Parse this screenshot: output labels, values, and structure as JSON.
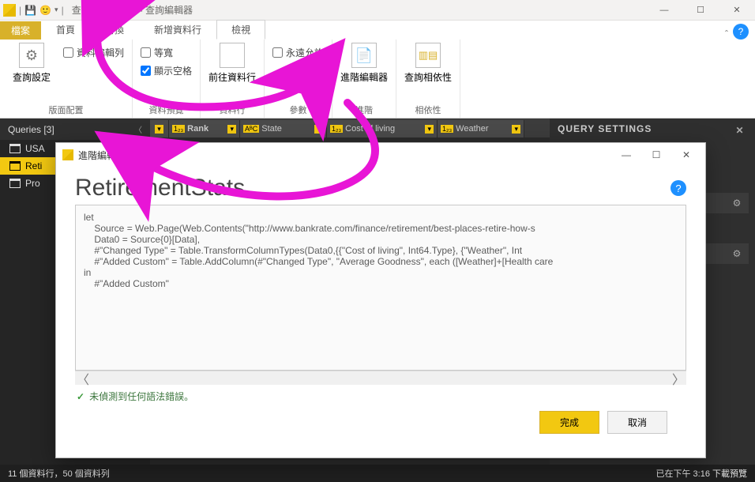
{
  "titlebar": {
    "title": "查詢工作 - 完成 - 查詢編輯器"
  },
  "ribbon": {
    "file": "檔案",
    "tabs": [
      "首頁",
      "轉換",
      "新增資料行",
      "檢視"
    ],
    "active_tab_index": 3,
    "group_layout": {
      "label": "版面配置",
      "query_settings": "查詢設定",
      "chk_formula_bar": "資料編輯列"
    },
    "group_preview": {
      "label": "資料預覽",
      "chk_monospace": "等寬",
      "chk_show_space": "顯示空格",
      "goto_col": "前往資料行"
    },
    "group_cols": {
      "label": "資料行"
    },
    "group_params": {
      "label": "參數",
      "chk_always_allow": "永遠允許"
    },
    "group_adv": {
      "label": "進階",
      "adv_editor": "進階編輯器"
    },
    "group_dep": {
      "label": "相依性",
      "dep_btn": "查詢相依性"
    }
  },
  "queries": {
    "header": "Queries [3]",
    "items": [
      "USA...",
      "RetirementStats",
      "Products"
    ],
    "items_short": [
      "USA",
      "Reti",
      "Pro"
    ],
    "selected_index": 1
  },
  "columns": [
    {
      "type": "1₂₃",
      "name": "Rank"
    },
    {
      "type": "AᴮC",
      "name": "State"
    },
    {
      "type": "1₂₃",
      "name": "Cost of living"
    },
    {
      "type": "1₂₃",
      "name": "Weather"
    }
  ],
  "settings": {
    "title": "QUERY SETTINGS"
  },
  "modal": {
    "win_title": "進階編輯器",
    "heading": "RetirementStats",
    "code": "let\n    Source = Web.Page(Web.Contents(\"http://www.bankrate.com/finance/retirement/best-places-retire-how-s\n    Data0 = Source{0}[Data],\n    #\"Changed Type\" = Table.TransformColumnTypes(Data0,{{\"Cost of living\", Int64.Type}, {\"Weather\", Int\n    #\"Added Custom\" = Table.AddColumn(#\"Changed Type\", \"Average Goodness\", each ([Weather]+[Health care\nin\n    #\"Added Custom\"",
    "status": "未偵測到任何語法錯誤。",
    "ok": "完成",
    "cancel": "取消"
  },
  "statusbar": {
    "left": "11 個資料行，50 個資料列",
    "right": "已在下午 3:16 下載預覽"
  }
}
